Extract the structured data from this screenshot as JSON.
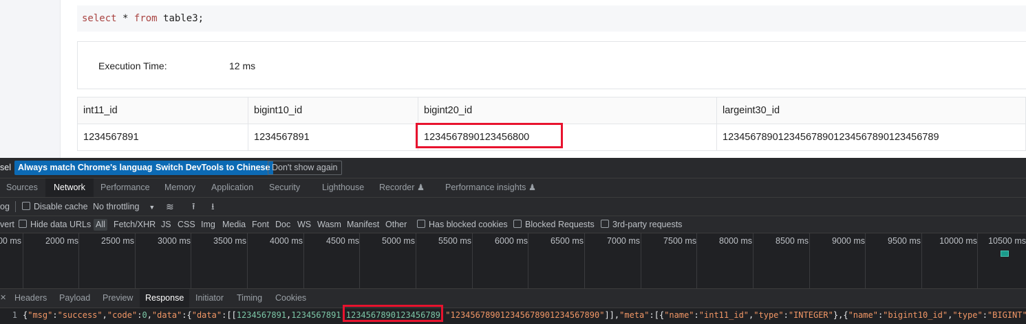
{
  "query": {
    "keyword_select": "select",
    "star": "*",
    "keyword_from": "from",
    "table": "table3;"
  },
  "execution": {
    "label": "Execution Time:",
    "value": "12 ms"
  },
  "result_table": {
    "columns": [
      "int11_id",
      "bigint10_id",
      "bigint20_id",
      "largeint30_id"
    ],
    "rows": [
      [
        "1234567891",
        "1234567891",
        "1234567890123456800",
        "123456789012345678901234567890123456789"
      ]
    ]
  },
  "devtools": {
    "infobar": {
      "text": "sel",
      "btn_match": "Always match Chrome's language",
      "btn_switch": "Switch DevTools to Chinese",
      "btn_dont": "Don't show again"
    },
    "tabs": [
      "Sources",
      "Network",
      "Performance",
      "Memory",
      "Application",
      "Security",
      "Lighthouse",
      "Recorder ♟",
      "Performance insights ♟"
    ],
    "toolbar": {
      "log": "og",
      "disable_cache": "Disable cache",
      "throttling": "No throttling"
    },
    "filters": [
      "vert",
      "Hide data URLs",
      "All",
      "Fetch/XHR",
      "JS",
      "CSS",
      "Img",
      "Media",
      "Font",
      "Doc",
      "WS",
      "Wasm",
      "Manifest",
      "Other",
      "Has blocked cookies",
      "Blocked Requests",
      "3rd-party requests"
    ],
    "timeline_ticks": [
      "00 ms",
      "2000 ms",
      "2500 ms",
      "3000 ms",
      "3500 ms",
      "4000 ms",
      "4500 ms",
      "5000 ms",
      "5500 ms",
      "6000 ms",
      "6500 ms",
      "7000 ms",
      "7500 ms",
      "8000 ms",
      "8500 ms",
      "9000 ms",
      "9500 ms",
      "10000 ms",
      "10500 ms"
    ],
    "subtabs": [
      "Headers",
      "Payload",
      "Preview",
      "Response",
      "Initiator",
      "Timing",
      "Cookies"
    ],
    "response": {
      "line_no": "1",
      "tokens": [
        [
          "p",
          "{"
        ],
        [
          "s",
          "\"msg\""
        ],
        [
          "p",
          ":"
        ],
        [
          "s",
          "\"success\""
        ],
        [
          "p",
          ","
        ],
        [
          "s",
          "\"code\""
        ],
        [
          "p",
          ":"
        ],
        [
          "n",
          "0"
        ],
        [
          "p",
          ","
        ],
        [
          "s",
          "\"data\""
        ],
        [
          "p",
          ":{"
        ],
        [
          "s",
          "\"data\""
        ],
        [
          "p",
          ":[["
        ],
        [
          "n",
          "1234567891"
        ],
        [
          "p",
          ","
        ],
        [
          "n",
          "1234567891"
        ],
        [
          "p",
          ","
        ],
        [
          "n",
          "1234567890123456789"
        ],
        [
          "p",
          " "
        ],
        [
          "s",
          "\"123456789012345678901234567890\""
        ],
        [
          "p",
          "]],"
        ],
        [
          "s",
          "\"meta\""
        ],
        [
          "p",
          ":[{"
        ],
        [
          "s",
          "\"name\""
        ],
        [
          "p",
          ":"
        ],
        [
          "s",
          "\"int11_id\""
        ],
        [
          "p",
          ","
        ],
        [
          "s",
          "\"type\""
        ],
        [
          "p",
          ":"
        ],
        [
          "s",
          "\"INTEGER\""
        ],
        [
          "p",
          "},{"
        ],
        [
          "s",
          "\"name\""
        ],
        [
          "p",
          ":"
        ],
        [
          "s",
          "\"bigint10_id\""
        ],
        [
          "p",
          ","
        ],
        [
          "s",
          "\"type\""
        ],
        [
          "p",
          ":"
        ],
        [
          "s",
          "\"BIGINT\""
        ],
        [
          "p",
          "},"
        ]
      ]
    }
  }
}
